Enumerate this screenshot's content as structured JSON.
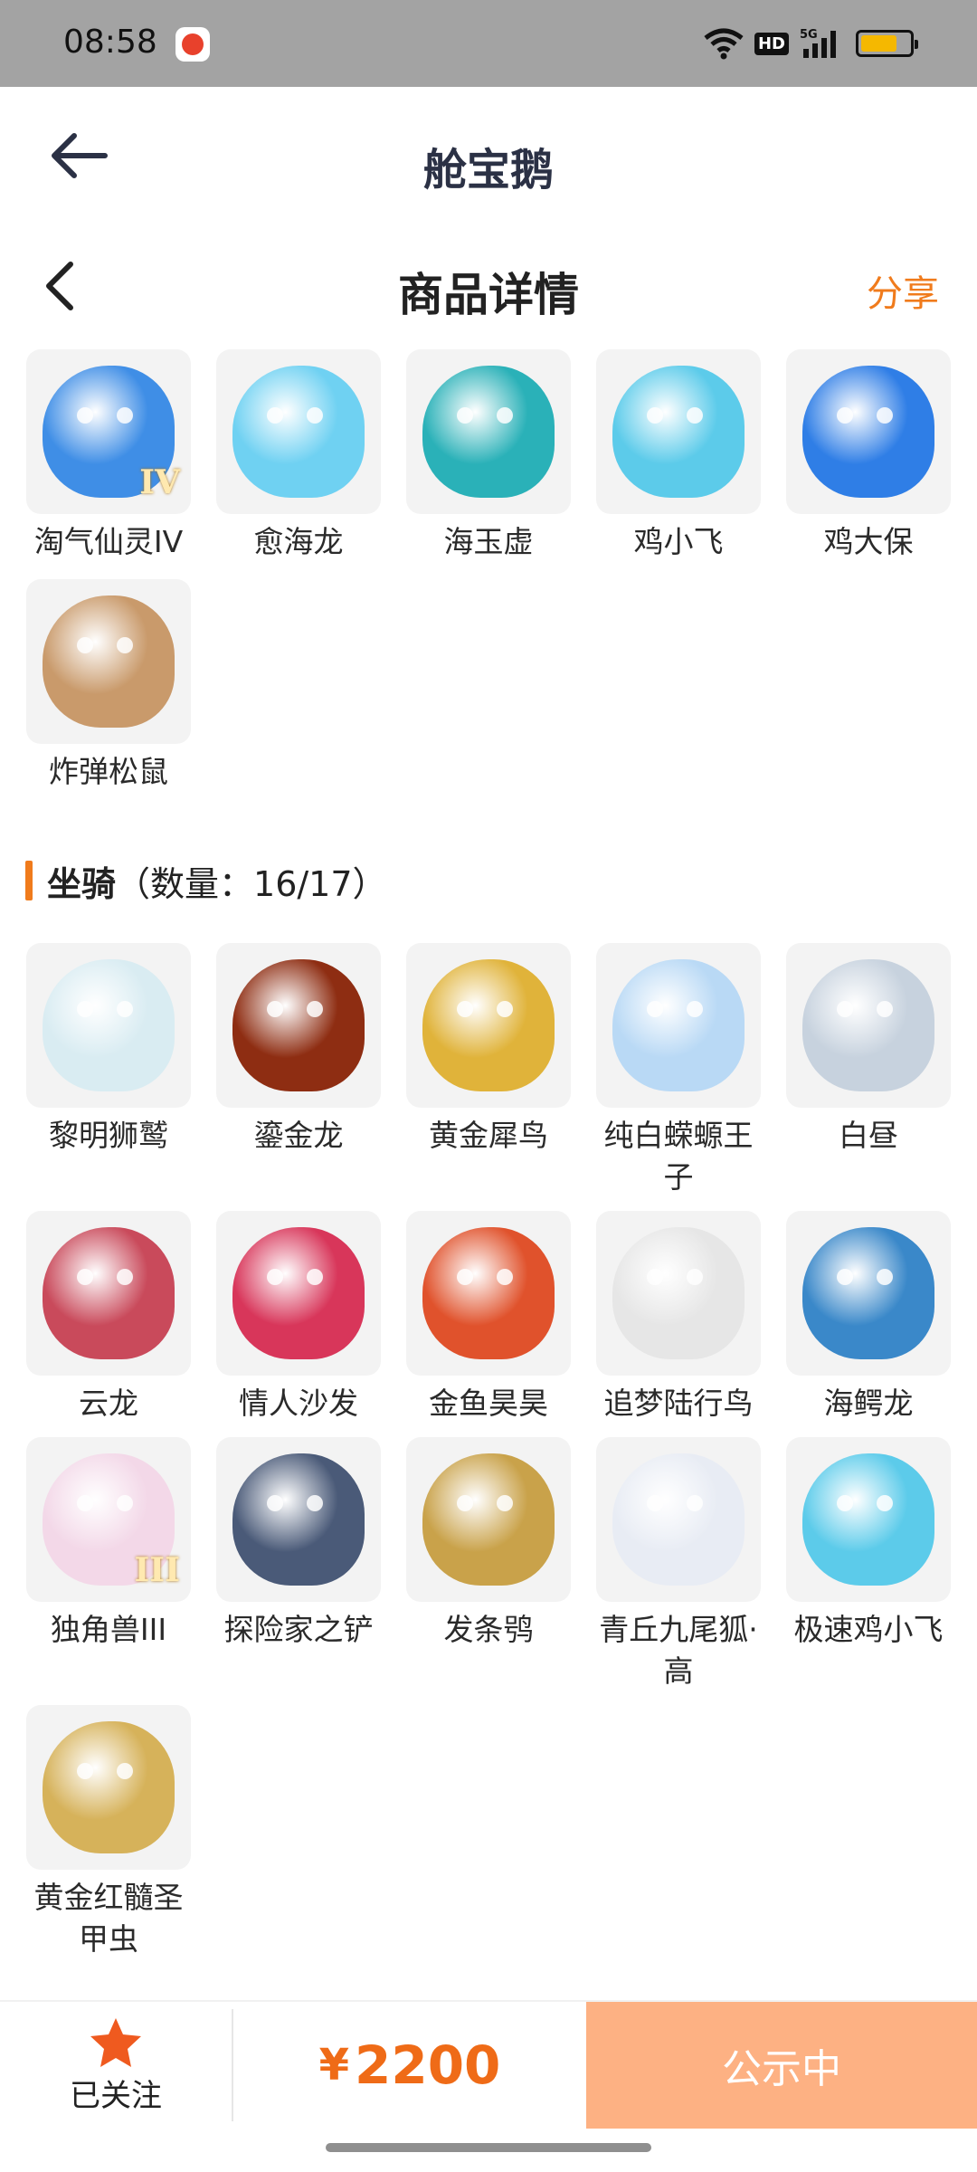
{
  "status_bar": {
    "time": "08:58",
    "hd_label": "HD",
    "network_label": "5G",
    "battery_level": 0.75,
    "battery_color": "#f5b800"
  },
  "app_header": {
    "title": "舱宝鹅",
    "back_icon": "arrow-left-icon"
  },
  "page_header": {
    "title": "商品详情",
    "share_label": "分享",
    "back_icon": "chevron-left-icon",
    "accent_color": "#f07b1c"
  },
  "pets": [
    {
      "name": "淘气仙灵IV",
      "badge": "IV",
      "color": "#3f8ee6"
    },
    {
      "name": "愈海龙",
      "badge": "",
      "color": "#6fd1f2"
    },
    {
      "name": "海玉虚",
      "badge": "",
      "color": "#2ab1b8"
    },
    {
      "name": "鸡小飞",
      "badge": "",
      "color": "#5ccbea"
    },
    {
      "name": "鸡大保",
      "badge": "",
      "color": "#2f7ee6"
    },
    {
      "name": "炸弹松鼠",
      "badge": "",
      "color": "#c99a6b"
    }
  ],
  "mounts_section": {
    "title": "坐骑",
    "count_text": "（数量：16/17）"
  },
  "mounts": [
    {
      "name": "黎明狮鹫",
      "badge": "",
      "color": "#d9ecf2"
    },
    {
      "name": "鎏金龙",
      "badge": "",
      "color": "#8e2d12"
    },
    {
      "name": "黄金犀鸟",
      "badge": "",
      "color": "#e0b33a"
    },
    {
      "name": "纯白蝾螈王子",
      "badge": "",
      "color": "#b9d9f5"
    },
    {
      "name": "白昼",
      "badge": "",
      "color": "#c7d2de"
    },
    {
      "name": "云龙",
      "badge": "",
      "color": "#c94a5b"
    },
    {
      "name": "情人沙发",
      "badge": "",
      "color": "#d8365a"
    },
    {
      "name": "金鱼昊昊",
      "badge": "",
      "color": "#e0522c"
    },
    {
      "name": "追梦陆行鸟",
      "badge": "",
      "color": "#e6e6e6"
    },
    {
      "name": "海鳄龙",
      "badge": "",
      "color": "#3a88c9"
    },
    {
      "name": "独角兽III",
      "badge": "III",
      "color": "#f3d8e8"
    },
    {
      "name": "探险家之铲",
      "badge": "",
      "color": "#4a5a78"
    },
    {
      "name": "发条鸮",
      "badge": "",
      "color": "#c9a24a"
    },
    {
      "name": "青丘九尾狐·高",
      "badge": "",
      "color": "#e8ecf4"
    },
    {
      "name": "极速鸡小飞",
      "badge": "",
      "color": "#5ccbea"
    },
    {
      "name": "黄金红髓圣甲虫",
      "badge": "",
      "color": "#d6b25a"
    }
  ],
  "bottom_bar": {
    "follow_label": "已关注",
    "follow_icon": "star-icon",
    "currency": "¥",
    "price": "2200",
    "action_label": "公示中",
    "action_color": "#fdb183"
  }
}
